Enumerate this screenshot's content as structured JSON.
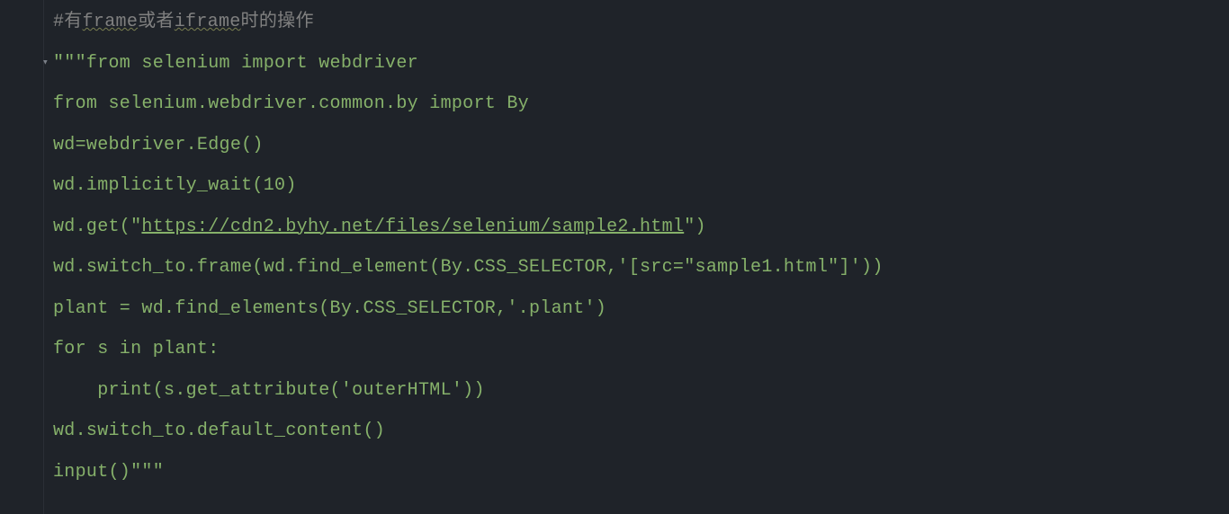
{
  "lines": [
    {
      "segments": [
        {
          "text": "#有",
          "cls": "c-comment"
        },
        {
          "text": "frame",
          "cls": "c-comment underline-squiggle"
        },
        {
          "text": "或者",
          "cls": "c-comment"
        },
        {
          "text": "iframe",
          "cls": "c-comment underline-squiggle"
        },
        {
          "text": "时的操作",
          "cls": "c-comment"
        }
      ],
      "fold": false
    },
    {
      "segments": [
        {
          "text": "\"\"\"from selenium import webdriver",
          "cls": "c-string"
        }
      ],
      "fold": true
    },
    {
      "segments": [
        {
          "text": "from selenium.webdriver.common.by import By",
          "cls": "c-string"
        }
      ],
      "fold": false
    },
    {
      "segments": [
        {
          "text": "wd=webdriver.Edge()",
          "cls": "c-string"
        }
      ],
      "fold": false
    },
    {
      "segments": [
        {
          "text": "wd.implicitly_wait(10)",
          "cls": "c-string"
        }
      ],
      "fold": false
    },
    {
      "segments": [
        {
          "text": "wd.get(\"",
          "cls": "c-string"
        },
        {
          "text": "https://cdn2.byhy.net/files/selenium/sample2.html",
          "cls": "c-string underline-link"
        },
        {
          "text": "\")",
          "cls": "c-string"
        }
      ],
      "fold": false
    },
    {
      "segments": [
        {
          "text": "wd.switch_to.frame(wd.find_element(By.CSS_SELECTOR,'[src=\"sample1.html\"]'))",
          "cls": "c-string"
        }
      ],
      "fold": false
    },
    {
      "segments": [
        {
          "text": "plant = wd.find_elements(By.CSS_SELECTOR,'.plant')",
          "cls": "c-string"
        }
      ],
      "fold": false
    },
    {
      "segments": [
        {
          "text": "for s in plant:",
          "cls": "c-string"
        }
      ],
      "fold": false
    },
    {
      "segments": [
        {
          "text": "    print(s.get_attribute('outerHTML'))",
          "cls": "c-string"
        }
      ],
      "fold": false
    },
    {
      "segments": [
        {
          "text": "wd.switch_to.default_content()",
          "cls": "c-string"
        }
      ],
      "fold": false
    },
    {
      "segments": [
        {
          "text": "input()\"\"\"",
          "cls": "c-string"
        }
      ],
      "fold": false
    }
  ]
}
